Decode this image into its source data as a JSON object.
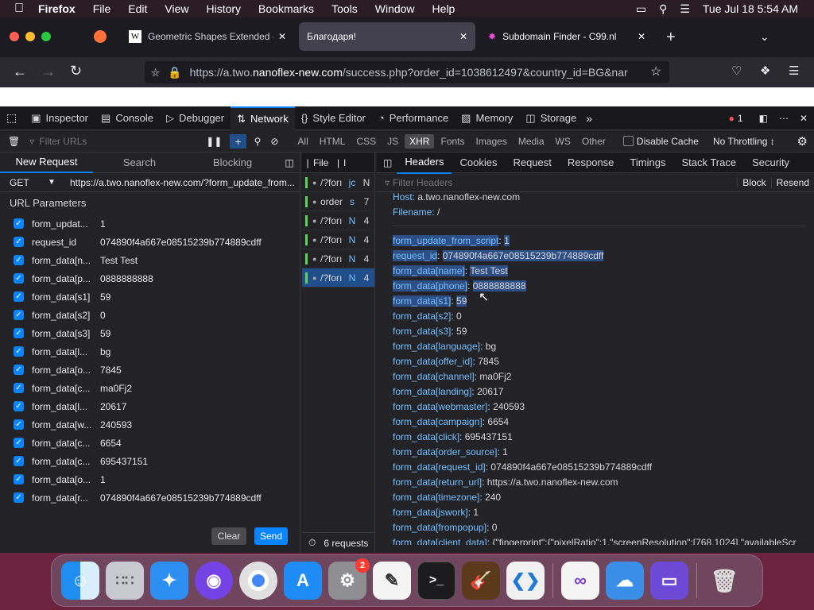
{
  "menubar": {
    "app": "Firefox",
    "items": [
      "File",
      "Edit",
      "View",
      "History",
      "Bookmarks",
      "Tools",
      "Window",
      "Help"
    ],
    "clock": "Tue Jul 18  5:54 AM"
  },
  "tabs": [
    {
      "label": "Geometric Shapes Extended - W",
      "active": false
    },
    {
      "label": "Благодаря!",
      "active": true
    },
    {
      "label": "Subdomain Finder - C99.nl",
      "active": false
    }
  ],
  "url": {
    "prefix": "https://a.two.",
    "domain": "nanoflex-new.com",
    "path": "/success.php?order_id=1038612497&country_id=BG&nar"
  },
  "devtools": {
    "tools": [
      "Inspector",
      "Console",
      "Debugger",
      "Network",
      "Style Editor",
      "Performance",
      "Memory",
      "Storage"
    ],
    "error_count": "1",
    "filter_placeholder": "Filter URLs",
    "types": [
      "All",
      "HTML",
      "CSS",
      "JS",
      "XHR",
      "Fonts",
      "Images",
      "Media",
      "WS",
      "Other"
    ],
    "disable_cache": "Disable Cache",
    "throttling": "No Throttling ↕"
  },
  "left": {
    "tabs": [
      "New Request",
      "Search",
      "Blocking"
    ],
    "method": "GET",
    "req_url": "https://a.two.nanoflex-new.com/?form_update_from...",
    "section": "URL Parameters",
    "params": [
      {
        "name": "form_updat...",
        "value": "1"
      },
      {
        "name": "request_id",
        "value": "074890f4a667e08515239b774889cdff"
      },
      {
        "name": "form_data[n...",
        "value": "Test Test"
      },
      {
        "name": "form_data[p...",
        "value": "0888888888"
      },
      {
        "name": "form_data[s1]",
        "value": "59"
      },
      {
        "name": "form_data[s2]",
        "value": "0"
      },
      {
        "name": "form_data[s3]",
        "value": "59"
      },
      {
        "name": "form_data[l...",
        "value": "bg"
      },
      {
        "name": "form_data[o...",
        "value": "7845"
      },
      {
        "name": "form_data[c...",
        "value": "ma0Fj2"
      },
      {
        "name": "form_data[l...",
        "value": "20617"
      },
      {
        "name": "form_data[w...",
        "value": "240593"
      },
      {
        "name": "form_data[c...",
        "value": "6654"
      },
      {
        "name": "form_data[c...",
        "value": "695437151"
      },
      {
        "name": "form_data[o...",
        "value": "1"
      },
      {
        "name": "form_data[r...",
        "value": "074890f4a667e08515239b774889cdff"
      }
    ],
    "clear": "Clear",
    "send": "Send"
  },
  "mid": {
    "headers": [
      "File",
      "I"
    ],
    "rows": [
      {
        "file": "/?forı",
        "init": "jc",
        "extra": "N",
        "sel": false
      },
      {
        "file": "order",
        "init": "s",
        "extra": "7",
        "sel": false
      },
      {
        "file": "/?forı",
        "init": "N",
        "extra": "4",
        "sel": false
      },
      {
        "file": "/?forı",
        "init": "N",
        "extra": "4",
        "sel": false
      },
      {
        "file": "/?forı",
        "init": "N",
        "extra": "4",
        "sel": false
      },
      {
        "file": "/?forı",
        "init": "N",
        "extra": "4",
        "sel": true
      }
    ],
    "status": "6 requests"
  },
  "details": {
    "tabs": [
      "Headers",
      "Cookies",
      "Request",
      "Response",
      "Timings",
      "Stack Trace",
      "Security"
    ],
    "filter_placeholder": "Filter Headers",
    "block": "Block",
    "resend": "Resend",
    "host_label": "Host:",
    "host": "a.two.nanoflex-new.com",
    "filename_label": "Filename:",
    "filename": "/",
    "fields": [
      {
        "k": "form_update_from_script",
        "v": "1",
        "hl": true
      },
      {
        "k": "request_id",
        "v": "074890f4a667e08515239b774889cdff",
        "hl": true
      },
      {
        "k": "form_data[name]",
        "v": "Test Test",
        "hl": true
      },
      {
        "k": "form_data[phone]",
        "v": "0888888888",
        "hl": true
      },
      {
        "k": "form_data[s1]",
        "v": "59",
        "hl": true
      },
      {
        "k": "form_data[s2]",
        "v": "0",
        "hl": false
      },
      {
        "k": "form_data[s3]",
        "v": "59",
        "hl": false
      },
      {
        "k": "form_data[language]",
        "v": "bg",
        "hl": false
      },
      {
        "k": "form_data[offer_id]",
        "v": "7845",
        "hl": false
      },
      {
        "k": "form_data[channel]",
        "v": "ma0Fj2",
        "hl": false
      },
      {
        "k": "form_data[landing]",
        "v": "20617",
        "hl": false
      },
      {
        "k": "form_data[webmaster]",
        "v": "240593",
        "hl": false
      },
      {
        "k": "form_data[campaign]",
        "v": "6654",
        "hl": false
      },
      {
        "k": "form_data[click]",
        "v": "695437151",
        "hl": false
      },
      {
        "k": "form_data[order_source]",
        "v": "1",
        "hl": false
      },
      {
        "k": "form_data[request_id]",
        "v": "074890f4a667e08515239b774889cdff",
        "hl": false
      },
      {
        "k": "form_data[return_url]",
        "v": "https://a.two.nanoflex-new.com",
        "hl": false
      },
      {
        "k": "form_data[timezone]",
        "v": "240",
        "hl": false
      },
      {
        "k": "form_data[jswork]",
        "v": "1",
        "hl": false
      },
      {
        "k": "form_data[frompopup]",
        "v": "0",
        "hl": false
      },
      {
        "k": "form_data[client_data]",
        "v": "{\"fingerprint\":{\"pixelRatio\":1,\"screenResolution\":[768,1024],\"availableScr",
        "hl": false
      }
    ]
  },
  "dock": {
    "badge": "2",
    "apps": [
      "finder",
      "launchpad",
      "safari",
      "firefox",
      "chrome",
      "app-store",
      "system-settings",
      "textedit",
      "terminal",
      "garageband",
      "vscode",
      "visual-studio",
      "weather",
      "simulator",
      "trash"
    ]
  }
}
